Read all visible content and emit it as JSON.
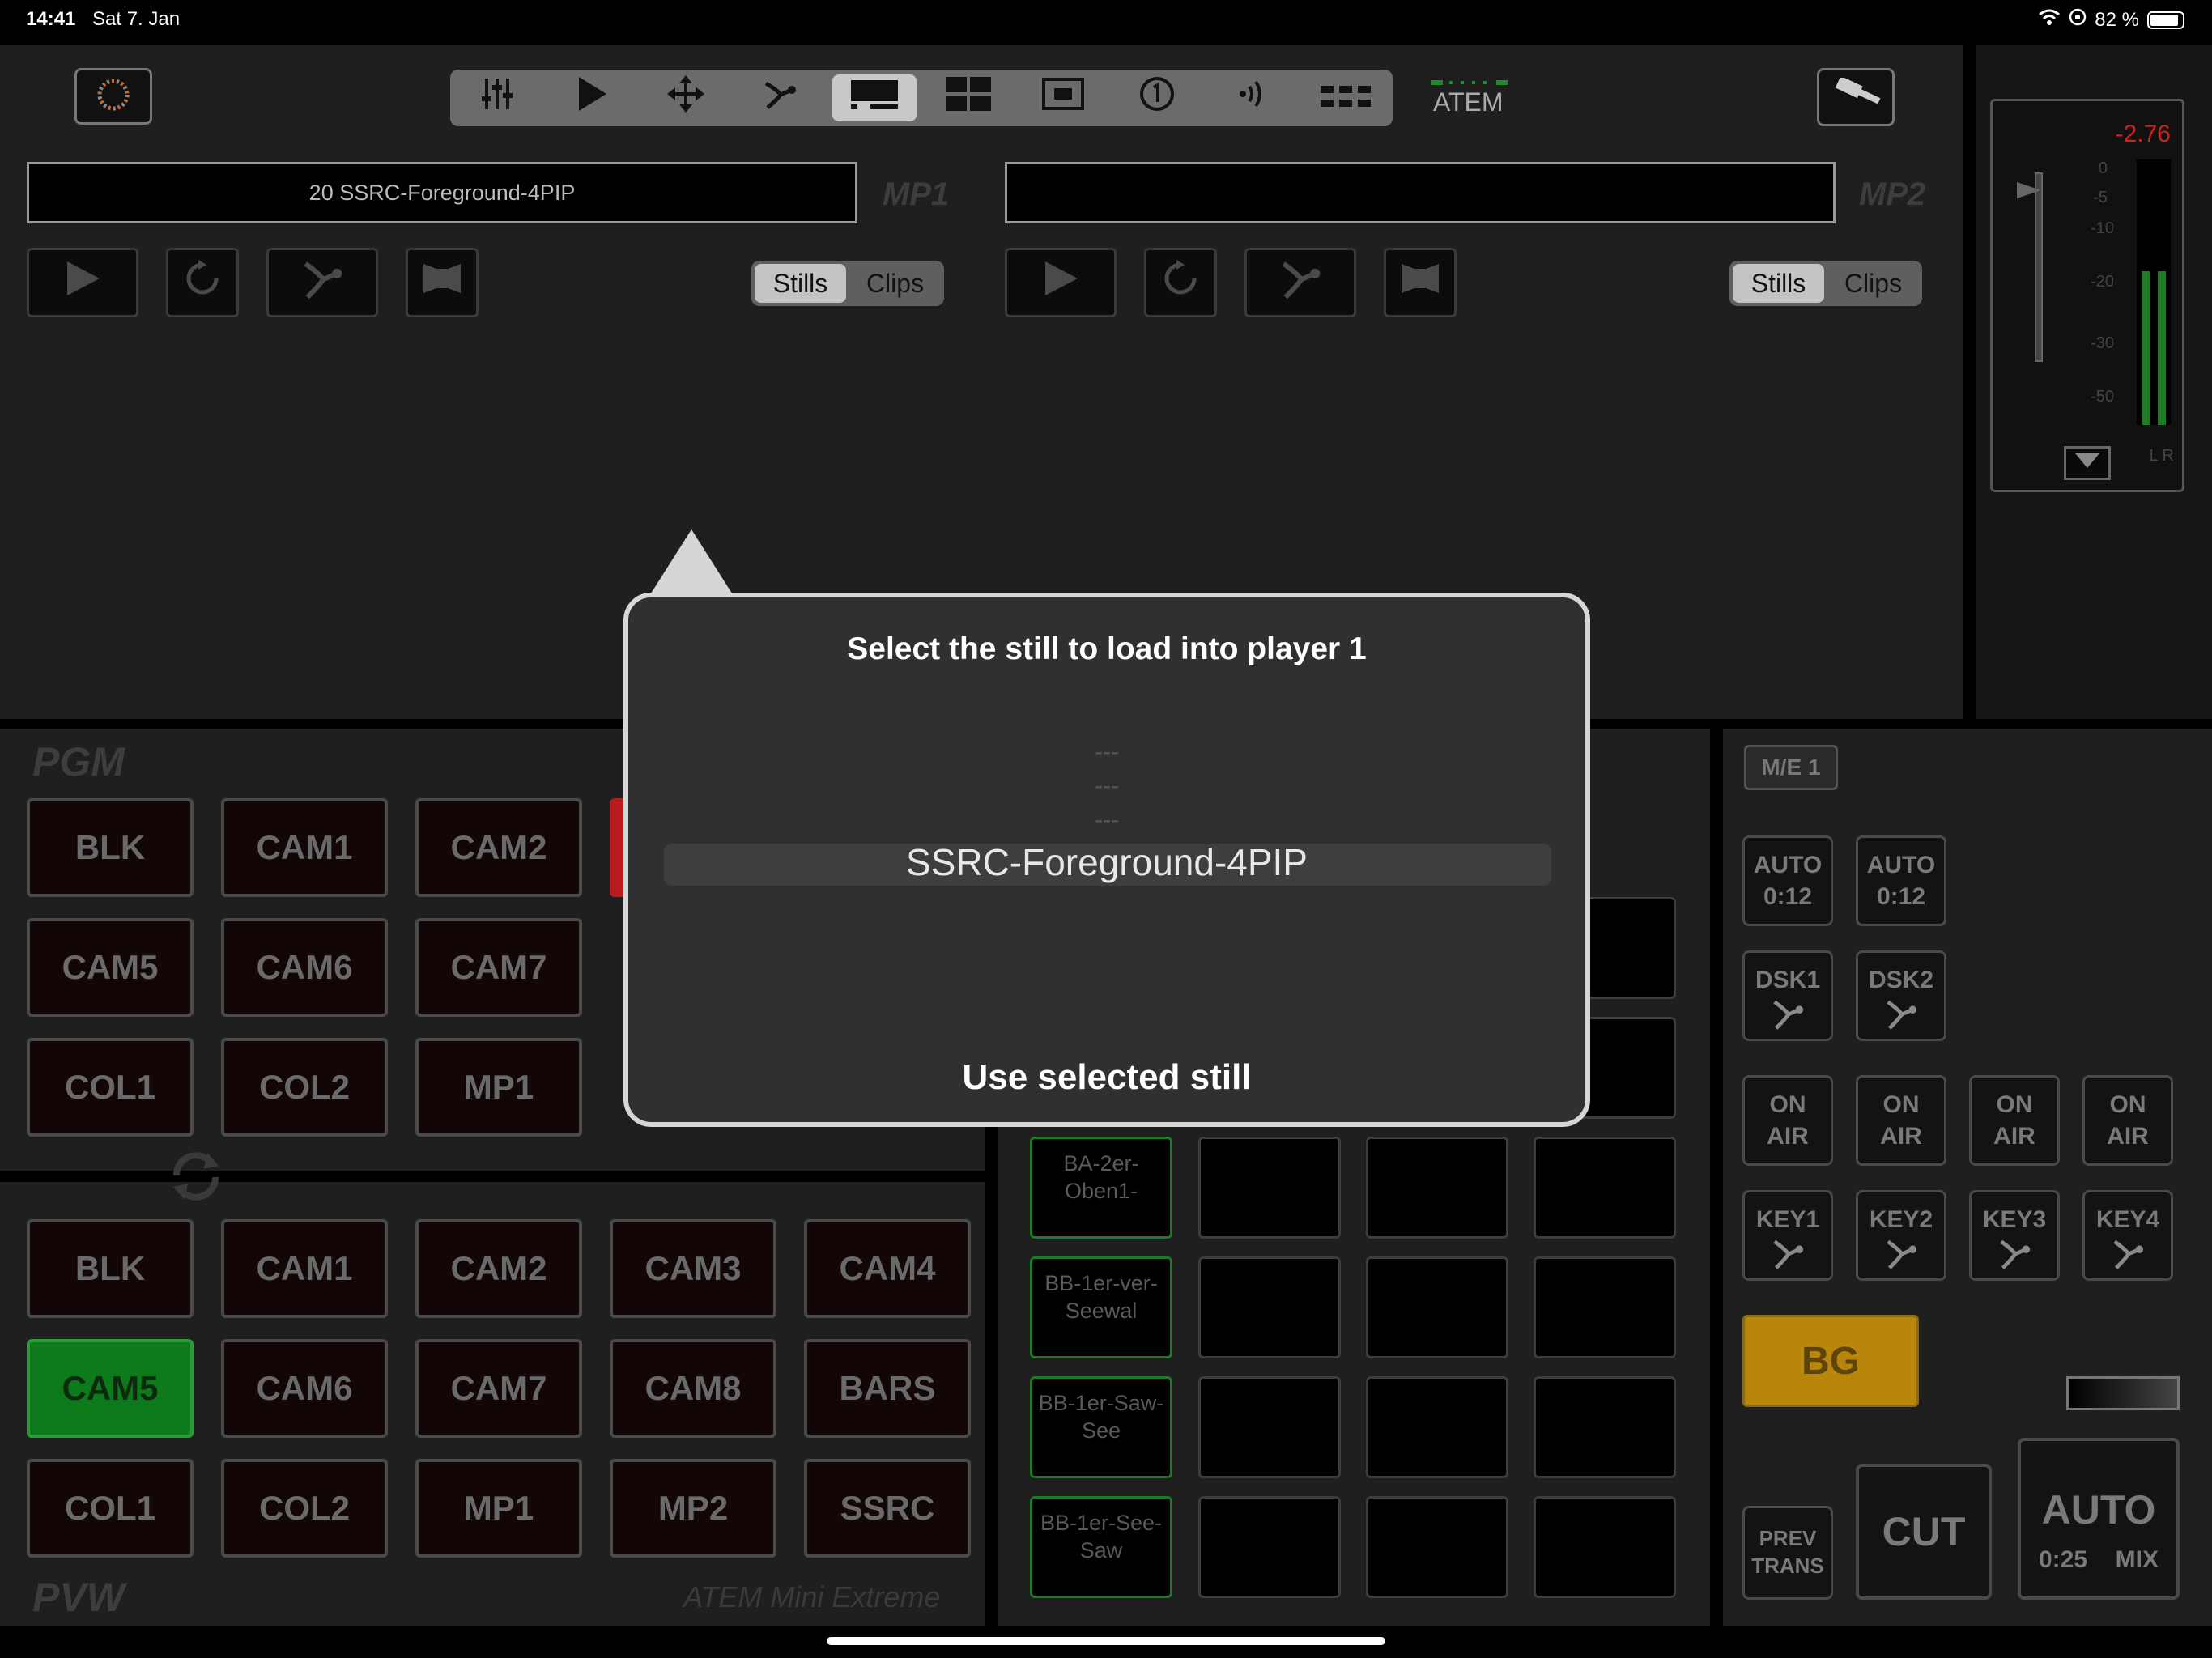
{
  "status": {
    "time": "14:41",
    "date": "Sat 7. Jan",
    "battery": "82 %"
  },
  "toolbar": {
    "atem_label": "ATEM"
  },
  "mp1": {
    "field": "20 SSRC-Foreground-4PIP",
    "label": "MP1",
    "stills": "Stills",
    "clips": "Clips"
  },
  "mp2": {
    "field": "",
    "label": "MP2",
    "stills": "Stills",
    "clips": "Clips"
  },
  "meter": {
    "value": "-2.76",
    "scale": [
      "0",
      "-5",
      "-10",
      "-20",
      "-30",
      "-50"
    ],
    "lr": "L R",
    "level_left": 0.58,
    "level_right": 0.58
  },
  "pgm": {
    "label": "PGM",
    "rows": [
      [
        "BLK",
        "CAM1",
        "CAM2"
      ],
      [
        "CAM5",
        "CAM6",
        "CAM7"
      ],
      [
        "COL1",
        "COL2",
        "MP1"
      ]
    ]
  },
  "pvw": {
    "label": "PVW",
    "model": "ATEM Mini Extreme",
    "rows": [
      [
        "BLK",
        "CAM1",
        "CAM2",
        "CAM3",
        "CAM4"
      ],
      [
        "CAM5",
        "CAM6",
        "CAM7",
        "CAM8",
        "BARS"
      ],
      [
        "COL1",
        "COL2",
        "MP1",
        "MP2",
        "SSRC"
      ]
    ],
    "active": "CAM5"
  },
  "macros": {
    "items": [
      "BA-2er-Oben1-",
      "BB-1er-ver-Seewal",
      "BB-1er-Saw-See",
      "BB-1er-See-Saw"
    ]
  },
  "me": {
    "label": "M/E 1",
    "auto1": [
      "AUTO",
      "0:12"
    ],
    "auto2": [
      "AUTO",
      "0:12"
    ],
    "dsk1": "DSK1",
    "dsk2": "DSK2",
    "onair": [
      "ON",
      "AIR"
    ],
    "keys": [
      "KEY1",
      "KEY2",
      "KEY3",
      "KEY4"
    ],
    "bg": "BG",
    "prev_trans": [
      "PREV",
      "TRANS"
    ],
    "cut": "CUT",
    "auto_main": "AUTO",
    "auto_time": "0:25",
    "auto_type": "MIX"
  },
  "popover": {
    "title": "Select the still to load into player 1",
    "placeholder": "---",
    "selected": "SSRC-Foreground-4PIP",
    "action": "Use selected still"
  },
  "colors": {
    "green": "#0d7a1c",
    "bg_amber": "#b8860b",
    "meter_red": "#cc2222"
  }
}
